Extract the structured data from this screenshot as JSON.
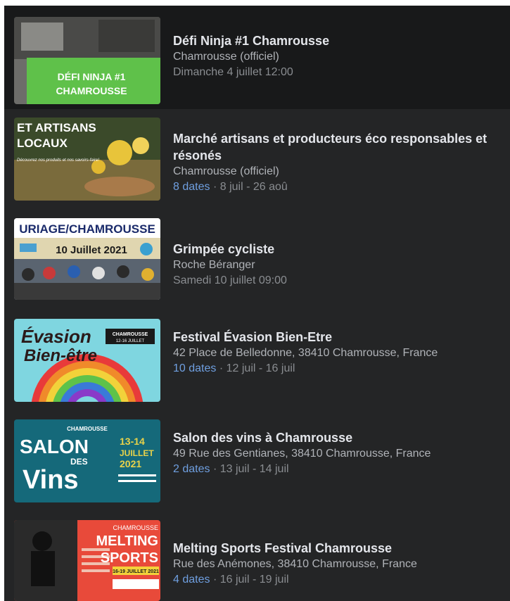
{
  "events": [
    {
      "title": "Défi Ninja #1 Chamrousse",
      "location": "Chamrousse (officiel)",
      "when": "Dimanche 4 juillet 12:00",
      "thumb_text": [
        "DÉFI NINJA #1",
        "CHAMROUSSE"
      ],
      "thumb_accent": "#5fc14a"
    },
    {
      "title": "Marché artisans et producteurs éco responsables et résonés",
      "location": "Chamrousse (officiel)",
      "dates_link": "8 dates",
      "separator": "·",
      "range": "8 juil - 26 aoû",
      "thumb_text": [
        "ET ARTISANS",
        "LOCAUX",
        "Découvrez nos produits et nos savoirs-faire!"
      ]
    },
    {
      "title": "Grimpée cycliste",
      "location": "Roche Béranger",
      "when": "Samedi 10 juillet 09:00",
      "thumb_text": [
        "URIAGE/CHAMROUSSE",
        "10 Juillet 2021"
      ]
    },
    {
      "title": "Festival Évasion Bien-Etre",
      "location": "42 Place de Belledonne, 38410 Chamrousse, France",
      "dates_link": "10 dates",
      "separator": "·",
      "range": "12 juil - 16 juil",
      "thumb_text": [
        "Évasion",
        "Bien-être",
        "CHAMROUSSE",
        "12-16 JUILLET"
      ]
    },
    {
      "title": "Salon des vins à Chamrousse",
      "location": "49 Rue des Gentianes, 38410 Chamrousse, France",
      "dates_link": "2 dates",
      "separator": "·",
      "range": "13 juil - 14 juil",
      "thumb_text": [
        "CHAMROUSSE",
        "SALON",
        "DES",
        "Vins",
        "13-14",
        "JUILLET",
        "2021"
      ]
    },
    {
      "title": "Melting Sports Festival Chamrousse",
      "location": "Rue des Anémones, 38410 Chamrousse, France",
      "dates_link": "4 dates",
      "separator": "·",
      "range": "16 juil - 19 juil",
      "thumb_text": [
        "CHAMROUSSE",
        "MELTING",
        "SPORTS",
        "16-19 JUILLET 2021"
      ]
    }
  ],
  "colors": {
    "panel": "#242526",
    "highlight": "#18191a",
    "title": "#e4e6eb",
    "link": "#6f9fe0"
  }
}
